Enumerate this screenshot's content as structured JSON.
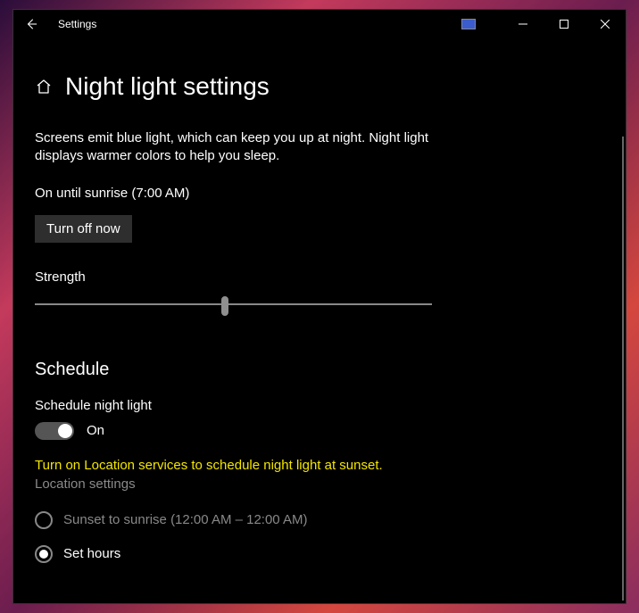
{
  "titlebar": {
    "title": "Settings"
  },
  "page": {
    "heading": "Night light settings",
    "description": "Screens emit blue light, which can keep you up at night. Night light displays warmer colors to help you sleep.",
    "status": "On until sunrise (7:00 AM)",
    "action_label": "Turn off now",
    "strength_label": "Strength",
    "strength_value": 48
  },
  "schedule": {
    "heading": "Schedule",
    "toggle_label": "Schedule night light",
    "toggle_state_label": "On",
    "toggle_on": true,
    "warning": "Turn on Location services to schedule night light at sunset.",
    "link": "Location settings",
    "options": [
      {
        "label": "Sunset to sunrise (12:00 AM – 12:00 AM)",
        "selected": false,
        "disabled": true
      },
      {
        "label": "Set hours",
        "selected": true,
        "disabled": false
      }
    ]
  }
}
